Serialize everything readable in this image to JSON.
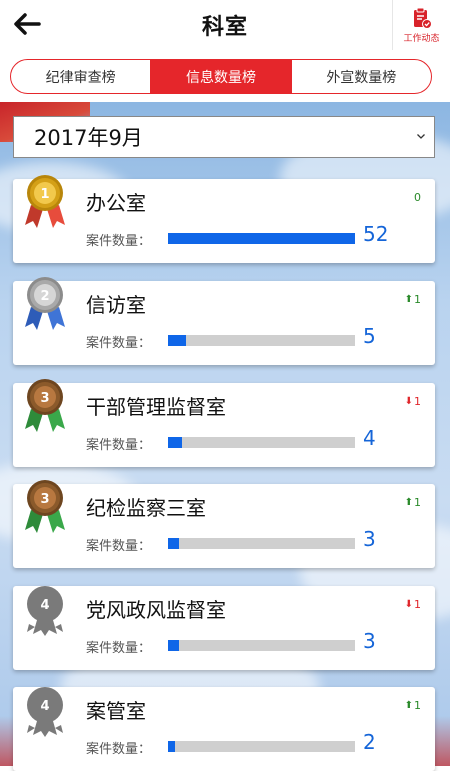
{
  "header": {
    "title": "科室",
    "work_label": "工作动态"
  },
  "tabs": [
    {
      "label": "纪律审查榜",
      "active": false
    },
    {
      "label": "信息数量榜",
      "active": true
    },
    {
      "label": "外宣数量榜",
      "active": false
    }
  ],
  "date_filter": {
    "value": "2017年9月"
  },
  "count_label": "案件数量：",
  "max_count": 52,
  "colors": {
    "accent": "#e5262b",
    "bar": "#0f66e8",
    "bar_track": "#cfcfcf",
    "count_text": "#1565d8",
    "trend_up": "#2a8a2a",
    "trend_down": "#e0262b"
  },
  "ranking": [
    {
      "rank": "1",
      "medal": "gold",
      "name": "办公室",
      "count": 52,
      "trend": "flat",
      "change": "0"
    },
    {
      "rank": "2",
      "medal": "silver",
      "name": "信访室",
      "count": 5,
      "trend": "up",
      "change": "1"
    },
    {
      "rank": "3",
      "medal": "bronze",
      "name": "干部管理监督室",
      "count": 4,
      "trend": "down",
      "change": "1"
    },
    {
      "rank": "3",
      "medal": "bronze",
      "name": "纪检监察三室",
      "count": 3,
      "trend": "up",
      "change": "1"
    },
    {
      "rank": "4",
      "medal": "gray",
      "name": "党风政风监督室",
      "count": 3,
      "trend": "down",
      "change": "1"
    },
    {
      "rank": "4",
      "medal": "gray",
      "name": "案管室",
      "count": 2,
      "trend": "up",
      "change": "1"
    }
  ]
}
